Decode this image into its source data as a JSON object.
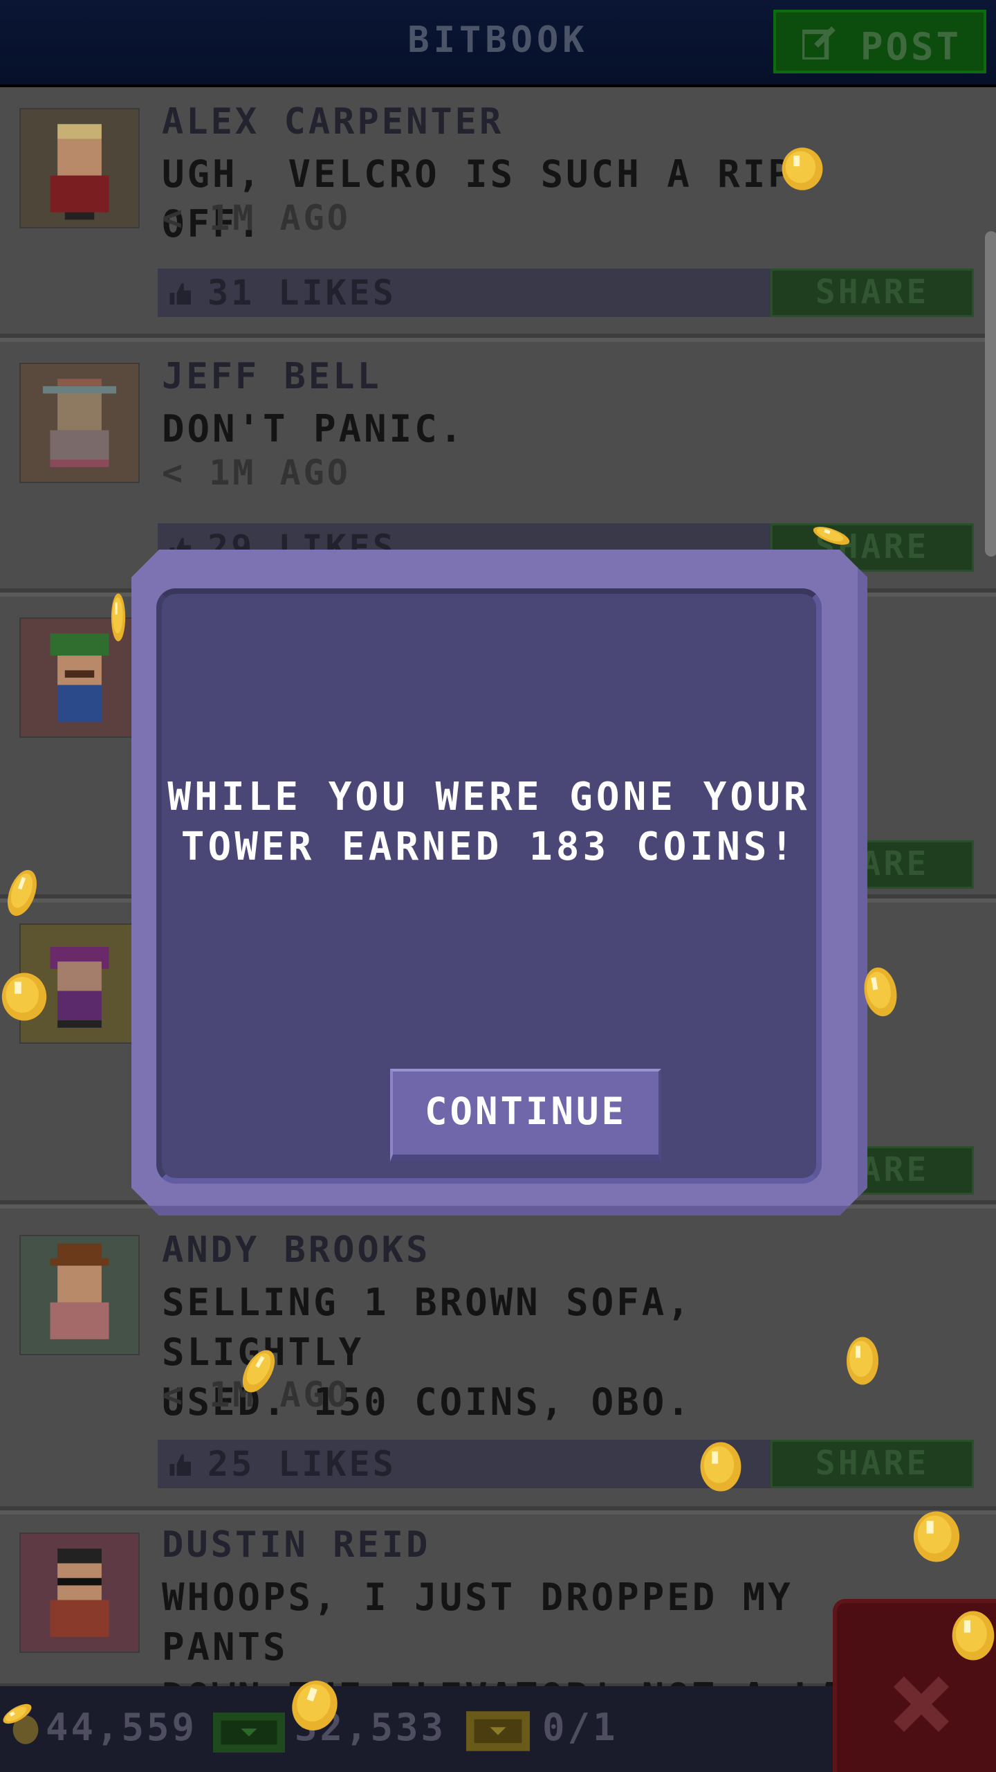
{
  "header": {
    "title": "BITBOOK",
    "post_label": "POST"
  },
  "posts": [
    {
      "name": "ALEX CARPENTER",
      "text": "UGH, VELCRO IS SUCH A RIP-OFF.",
      "time": "< 1M AGO",
      "likes": "31 LIKES",
      "share": "SHARE",
      "avatar_bg": "#4f463a"
    },
    {
      "name": "JEFF BELL",
      "text": "DON'T PANIC.",
      "time": "< 1M AGO",
      "likes": "29 LIKES",
      "share": "SHARE",
      "avatar_bg": "#5a4a3e"
    },
    {
      "name": "",
      "text": "",
      "time": "",
      "likes": "",
      "share": "SHARE",
      "avatar_bg": "#5c3f3f"
    },
    {
      "name": "",
      "text": "",
      "time": "",
      "likes": "",
      "share": "SHARE",
      "avatar_bg": "#5d5530"
    },
    {
      "name": "ANDY BROOKS",
      "text": "SELLING 1 BROWN SOFA, SLIGHTLY\nUSED. 150 COINS, OBO.",
      "time": "< 1M AGO",
      "likes": "25 LIKES",
      "share": "SHARE",
      "avatar_bg": "#445247"
    },
    {
      "name": "DUSTIN REID",
      "text": "WHOOPS, I JUST DROPPED MY PANTS\nDOWN THE ELEVATOR! NOT A LAU",
      "time": "",
      "likes": "",
      "share": "",
      "avatar_bg": "#5e3a45"
    }
  ],
  "modal": {
    "message": "WHILE YOU WERE GONE YOUR\nTOWER EARNED 183 COINS!",
    "continue_label": "CONTINUE"
  },
  "footer": {
    "coins": "44,559",
    "bux": "32,533",
    "chests": "0/1"
  },
  "colors": {
    "coin": "#f5c842",
    "modal": "#4a4776",
    "share": "#1f3d1f"
  },
  "icons": [
    "edit-icon",
    "thumb-up-icon",
    "coin-icon",
    "bux-icon",
    "chest-icon",
    "close-icon"
  ]
}
